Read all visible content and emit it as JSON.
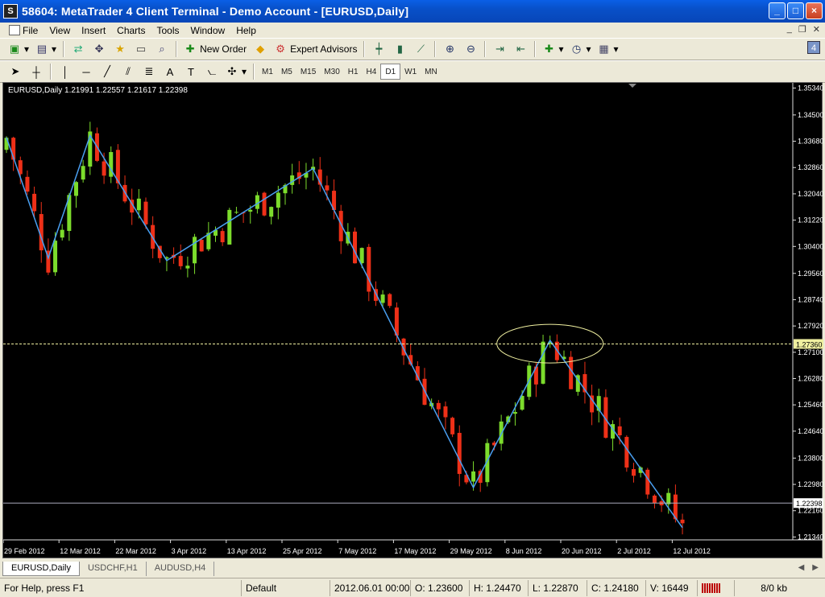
{
  "window": {
    "title": "58604: MetaTrader 4 Client Terminal - Demo Account - [EURUSD,Daily]"
  },
  "menu": [
    "File",
    "View",
    "Insert",
    "Charts",
    "Tools",
    "Window",
    "Help"
  ],
  "toolbar": {
    "new_order": "New Order",
    "expert_advisors": "Expert Advisors",
    "badge": "4"
  },
  "timeframes": [
    "M1",
    "M5",
    "M15",
    "M30",
    "H1",
    "H4",
    "D1",
    "W1",
    "MN"
  ],
  "active_timeframe": "D1",
  "chart": {
    "symbol_label": "EURUSD,Daily  1.21991 1.22557 1.21617 1.22398",
    "price_ticks": [
      "1.35340",
      "1.34500",
      "1.33680",
      "1.32860",
      "1.32040",
      "1.31220",
      "1.30400",
      "1.29560",
      "1.28740",
      "1.27920",
      "1.27100",
      "1.26280",
      "1.25460",
      "1.24640",
      "1.23800",
      "1.22980",
      "1.22160",
      "1.21340"
    ],
    "date_ticks": [
      "29 Feb 2012",
      "12 Mar 2012",
      "22 Mar 2012",
      "3 Apr 2012",
      "13 Apr 2012",
      "25 Apr 2012",
      "7 May 2012",
      "17 May 2012",
      "29 May 2012",
      "8 Jun 2012",
      "20 Jun 2012",
      "2 Jul 2012",
      "12 Jul 2012"
    ],
    "hline_price": "1.27360",
    "bid_price": "1.22398",
    "colors": {
      "bull": "#7cdc2c",
      "bear": "#ee3018",
      "zigzag": "#4a9ff0",
      "ellipse": "#f0f0a0",
      "hline": "#f0f0a0",
      "bid_bg": "#ffffff"
    }
  },
  "chart_data": {
    "type": "candlestick",
    "ylim": [
      1.2125,
      1.355
    ],
    "zigzag": [
      {
        "date": "29 Feb 2012",
        "price": 1.338
      },
      {
        "date": "8 Mar 2012",
        "price": 1.3004
      },
      {
        "date": "16 Mar 2012",
        "price": 1.3386
      },
      {
        "date": "2 Apr 2012",
        "price": 1.2996
      },
      {
        "date": "1 May 2012",
        "price": 1.3283
      },
      {
        "date": "1 Jun 2012",
        "price": 1.2288
      },
      {
        "date": "18 Jun 2012",
        "price": 1.2747
      },
      {
        "date": "13 Jul 2012",
        "price": 1.2163
      }
    ],
    "hline": 1.2736,
    "bid": 1.22398
  },
  "tabs": [
    "EURUSD,Daily",
    "USDCHF,H1",
    "AUDUSD,H4"
  ],
  "status": {
    "help": "For Help, press F1",
    "profile": "Default",
    "datetime": "2012.06.01 00:00",
    "open": "O: 1.23600",
    "high": "H: 1.24470",
    "low": "L: 1.22870",
    "close": "C: 1.24180",
    "volume": "V: 16449",
    "traffic": "8/0 kb"
  }
}
